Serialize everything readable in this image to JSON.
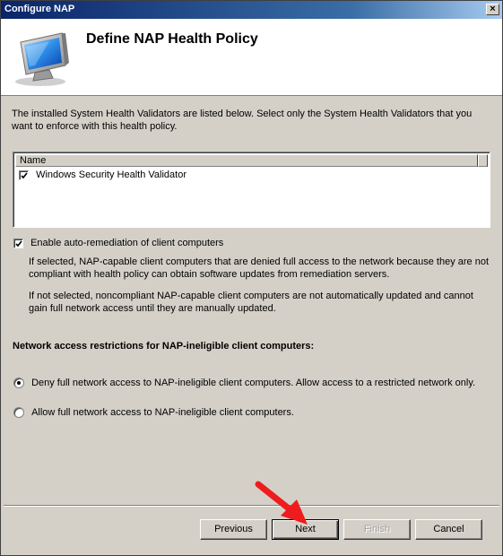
{
  "window": {
    "title": "Configure NAP",
    "close_label": "×"
  },
  "header": {
    "heading": "Define NAP Health Policy",
    "icon": "computer-monitor-icon"
  },
  "intro_text": "The installed System Health Validators are listed below. Select only the System Health Validators that you want to enforce with this health policy.",
  "validators": {
    "column_name": "Name",
    "items": [
      {
        "label": "Windows Security Health Validator",
        "checked": true
      }
    ]
  },
  "auto_remediation": {
    "label": "Enable auto-remediation of client computers",
    "checked": true,
    "desc_selected": "If selected, NAP-capable client computers that are denied full access to the network because they are not compliant with health policy can obtain software updates from remediation servers.",
    "desc_not_selected": "If not selected, noncompliant NAP-capable client computers are not automatically updated and cannot gain full network access until they are manually updated."
  },
  "restrictions": {
    "heading": "Network access restrictions for NAP-ineligible client computers:",
    "options": [
      {
        "label": "Deny full network access to NAP-ineligible client computers. Allow access to a restricted network only.",
        "selected": true
      },
      {
        "label": "Allow full network access to NAP-ineligible client computers.",
        "selected": false
      }
    ]
  },
  "buttons": {
    "previous": "Previous",
    "next": "Next",
    "finish": "Finish",
    "cancel": "Cancel"
  },
  "annotation": {
    "arrow_color": "#ee1c1c"
  },
  "colors": {
    "titlebar_start": "#0a246a",
    "titlebar_end": "#a6caf0",
    "dialog_bg": "#d4d0c8"
  }
}
